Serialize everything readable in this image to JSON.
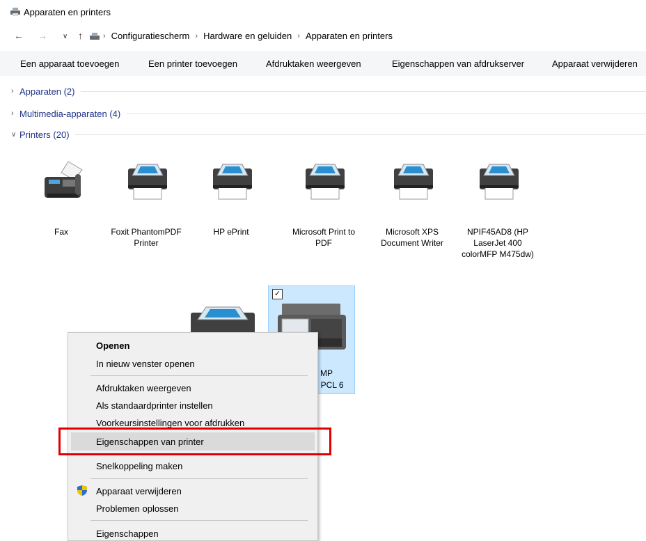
{
  "window": {
    "title": "Apparaten en printers"
  },
  "breadcrumb": [
    "Configuratiescherm",
    "Hardware en geluiden",
    "Apparaten en printers"
  ],
  "commands": [
    "Een apparaat toevoegen",
    "Een printer toevoegen",
    "Afdruktaken weergeven",
    "Eigenschappen van afdrukserver",
    "Apparaat verwijderen"
  ],
  "groups": [
    {
      "label": "Apparaten (2)",
      "expanded": false
    },
    {
      "label": "Multimedia-apparaten (4)",
      "expanded": false
    },
    {
      "label": "Printers (20)",
      "expanded": true
    }
  ],
  "printers": [
    {
      "label": "Fax",
      "icon": "fax-icon"
    },
    {
      "label": "Foxit PhantomPDF Printer",
      "icon": "printer-icon"
    },
    {
      "label": "HP ePrint",
      "icon": "printer-icon"
    },
    {
      "label": "Microsoft Print to PDF",
      "icon": "printer-icon"
    },
    {
      "label": "Microsoft XPS Document Writer",
      "icon": "printer-icon"
    },
    {
      "label": "NPIF45AD8 (HP LaserJet 400 colorMFP M475dw)",
      "icon": "printer-icon"
    }
  ],
  "selected_printer_partial_label": [
    "l MP",
    ": PCL 6"
  ],
  "context_menu": {
    "items": [
      {
        "label": "Openen",
        "bold": true
      },
      {
        "label": "In nieuw venster openen"
      },
      {
        "label": "Afdruktaken weergeven"
      },
      {
        "label": "Als standaardprinter instellen"
      },
      {
        "label": "Voorkeursinstellingen voor afdrukken"
      },
      {
        "label": "Eigenschappen van printer",
        "highlighted": true
      },
      {
        "label": "Snelkoppeling maken"
      },
      {
        "label": "Apparaat verwijderen",
        "icon": "uac-shield-icon"
      },
      {
        "label": "Problemen oplossen"
      },
      {
        "label": "Eigenschappen"
      }
    ]
  },
  "colors": {
    "group_label": "#1e3287",
    "selection": "#cce8ff",
    "highlight_box": "#e00000"
  }
}
